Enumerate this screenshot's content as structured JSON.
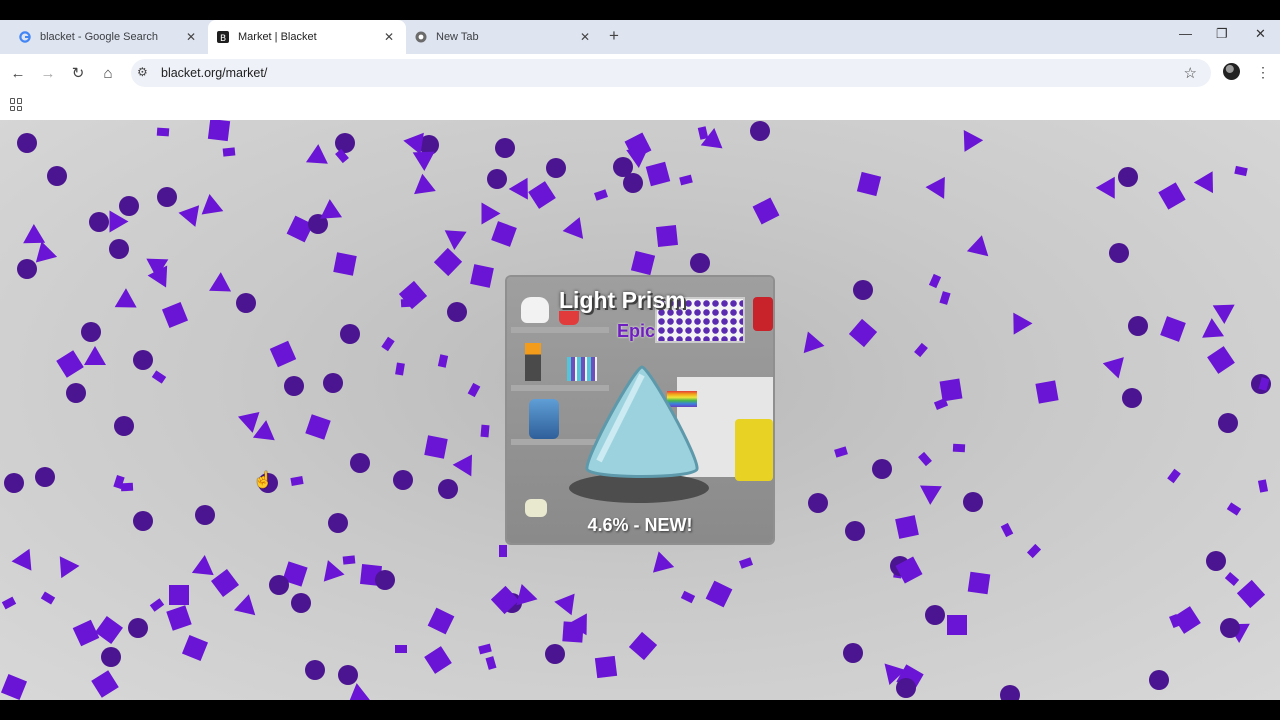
{
  "browser": {
    "tabs": [
      {
        "title": "blacket - Google Search",
        "icon": "google-icon"
      },
      {
        "title": "Market | Blacket",
        "icon": "blacket-icon"
      },
      {
        "title": "New Tab",
        "icon": "chrome-icon"
      }
    ],
    "active_tab": 1,
    "url": "blacket.org/market/"
  },
  "card": {
    "title": "Light Prism",
    "rarity": "Epic",
    "odds": "4.6% - NEW!"
  },
  "colors": {
    "accent": "#6a14d6",
    "accent_dark": "#4b1490",
    "background": "#c9c9c9"
  }
}
